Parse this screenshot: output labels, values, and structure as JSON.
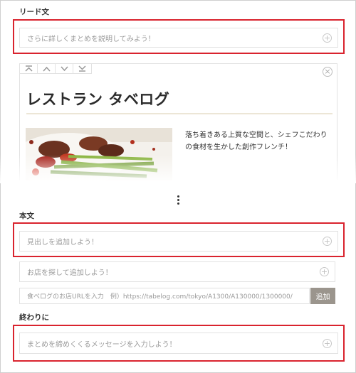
{
  "lead": {
    "label": "リード文",
    "placeholder": "さらに詳しくまとめを説明してみよう！"
  },
  "card": {
    "title": "レストラン タベログ",
    "description": "落ち着きある上質な空間と、シェフこだわりの食材を生かした創作フレンチ！",
    "controls": [
      "move-top-icon",
      "move-up-icon",
      "move-down-icon",
      "move-bottom-icon"
    ]
  },
  "body": {
    "label": "本文",
    "heading_placeholder": "見出しを追加しよう！",
    "restaurant_placeholder": "お店を探して追加しよう！",
    "url_placeholder": "食べログのお店URLを入力　例）https://tabelog.com/tokyo/A1300/A130000/1300000/",
    "add_label": "追加"
  },
  "ending": {
    "label": "終わりに",
    "placeholder": "まとめを締めくくるメッセージを入力しよう！"
  },
  "colors": {
    "highlight": "#d9232e",
    "button": "#9b958d"
  }
}
